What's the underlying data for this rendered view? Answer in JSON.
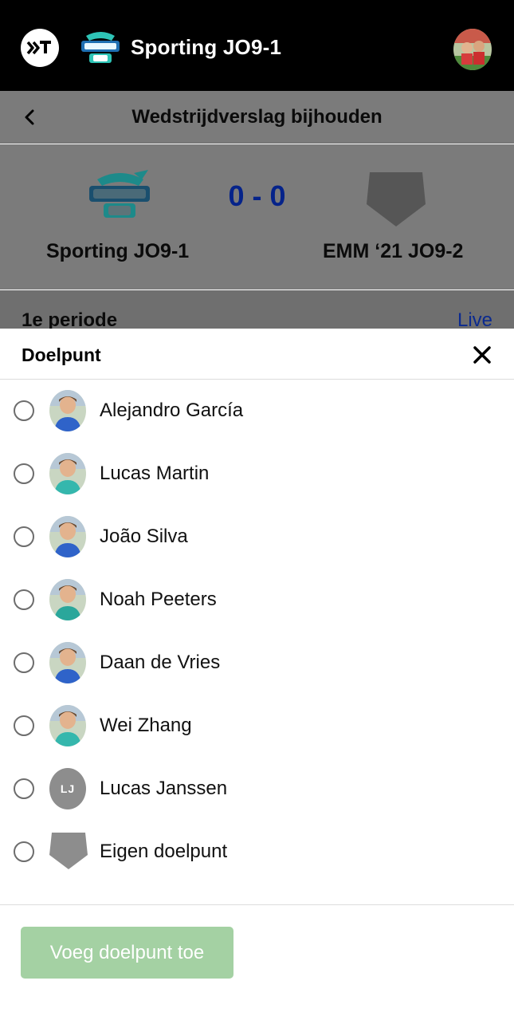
{
  "header": {
    "team_title": "Sporting JO9-1"
  },
  "subheader": {
    "title": "Wedstrijdverslag bijhouden"
  },
  "match": {
    "home_team": "Sporting JO9-1",
    "away_team": "EMM ‘21 JO9-2",
    "score": "0 - 0"
  },
  "period": {
    "label": "1e periode",
    "live": "Live"
  },
  "sheet": {
    "title": "Doelpunt",
    "players": [
      {
        "name": "Alejandro García",
        "avatar": "photo",
        "color": "#2f63c9"
      },
      {
        "name": "Lucas Martin",
        "avatar": "photo",
        "color": "#35b7ad"
      },
      {
        "name": "João Silva",
        "avatar": "photo",
        "color": "#2f63c9"
      },
      {
        "name": "Noah Peeters",
        "avatar": "photo",
        "color": "#2aa79b"
      },
      {
        "name": "Daan de Vries",
        "avatar": "photo",
        "color": "#2f63c9"
      },
      {
        "name": "Wei Zhang",
        "avatar": "photo",
        "color": "#35b7ad"
      },
      {
        "name": "Lucas Janssen",
        "avatar": "initials",
        "initials": "LJ"
      },
      {
        "name": "Eigen doelpunt",
        "avatar": "pentagon"
      }
    ],
    "add_button": "Voeg doelpunt toe"
  },
  "colors": {
    "score": "#05238a",
    "live": "#0b2a8f",
    "button_disabled": "#a4d1a3",
    "overlay_gray": "#7b7b7b"
  }
}
